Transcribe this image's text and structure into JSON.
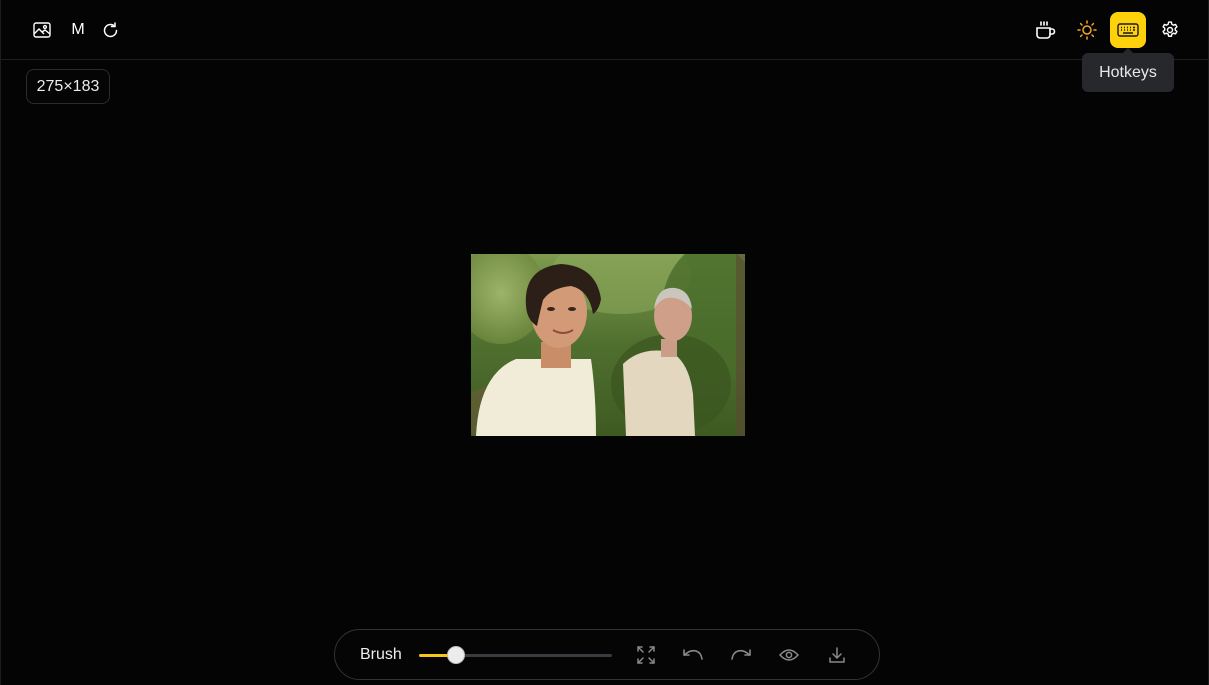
{
  "header": {
    "left_icons": [
      "image-icon",
      "m-text",
      "refresh-icon"
    ],
    "m_label": "M",
    "right_icons": [
      "coffee-icon",
      "sun-icon",
      "keyboard-icon",
      "gear-icon"
    ],
    "active_icon": "keyboard-icon"
  },
  "image_size": "275×183",
  "tooltip": "Hotkeys",
  "toolbar": {
    "brush_label": "Brush",
    "brush_value": 0.19,
    "buttons": [
      "fit-screen-icon",
      "undo-icon",
      "redo-icon",
      "eye-icon",
      "download-icon"
    ]
  },
  "colors": {
    "accent": "#fdd20a",
    "background": "#040404",
    "sun": "#f5a623"
  }
}
